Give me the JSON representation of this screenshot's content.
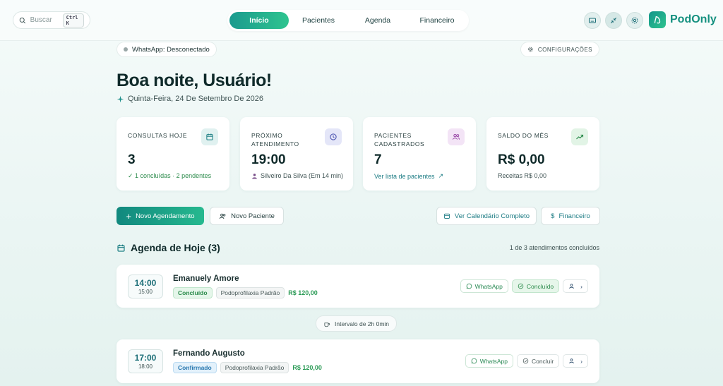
{
  "topbar": {
    "search": {
      "placeholder": "Buscar",
      "shortcut": "Ctrl K"
    },
    "nav": [
      {
        "label": "Início",
        "active": true
      },
      {
        "label": "Pacientes",
        "active": false
      },
      {
        "label": "Agenda",
        "active": false
      },
      {
        "label": "Financeiro",
        "active": false
      }
    ],
    "icons": [
      "keyboard-icon",
      "collapse-icon",
      "gear-icon"
    ],
    "brand": "PodOnly"
  },
  "status": {
    "whatsapp": "WhatsApp: Desconectado",
    "config": "CONFIGURAÇÕES"
  },
  "greeting": "Boa noite, Usuário!",
  "date": "Quinta-Feira, 24 De Setembro De 2026",
  "cards": {
    "today": {
      "title": "CONSULTAS HOJE",
      "value": "3",
      "sub": "✓ 1 concluídas · 2 pendentes"
    },
    "next": {
      "title_l1": "PRÓXIMO",
      "title_l2": "ATENDIMENTO",
      "value": "19:00",
      "sub": "Silveiro Da Silva (Em 14 min)"
    },
    "patients": {
      "title_l1": "PACIENTES",
      "title_l2": "CADASTRADOS",
      "value": "7",
      "sub": "Ver lista de pacientes"
    },
    "balance": {
      "title": "SALDO DO MÊS",
      "value": "R$ 0,00",
      "sub": "Receitas R$ 0,00"
    }
  },
  "actions": {
    "new_appt": "Novo Agendamento",
    "new_patient": "Novo Paciente",
    "calendar": "Ver Calendário Completo",
    "finance": "Financeiro"
  },
  "agenda": {
    "title": "Agenda de Hoje (3)",
    "summary": "1 de 3 atendimentos concluídos",
    "interval": "Intervalo de 2h 0min",
    "items": [
      {
        "start": "14:00",
        "end": "15:00",
        "name": "Emanuely Amore",
        "status": "Concluído",
        "procedure": "Podoprofilaxia Padrão",
        "price": "R$ 120,00",
        "wa": "WhatsApp",
        "done_label": "Concluído"
      },
      {
        "start": "17:00",
        "end": "18:00",
        "name": "Fernando Augusto",
        "status": "Confirmado",
        "procedure": "Podoprofilaxia Padrão",
        "price": "R$ 120,00",
        "wa": "WhatsApp",
        "done_label": "Concluir"
      }
    ]
  },
  "colors": {
    "accent": "#1b9a8e",
    "accent2": "#2fc48f",
    "success": "#2a8a4a",
    "info": "#2a79b0"
  }
}
